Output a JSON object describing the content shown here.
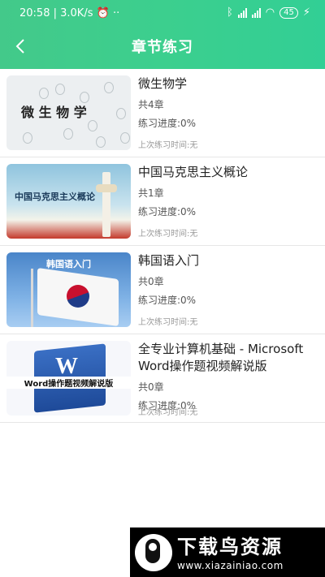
{
  "status_bar": {
    "time": "20:58",
    "speed": "3.0K/s",
    "more": "··",
    "battery": "45"
  },
  "header": {
    "back_icon": "chevron-left-icon",
    "title": "章节练习"
  },
  "courses": [
    {
      "title": "微生物学",
      "chapters": "共4章",
      "progress": "练习进度:0%",
      "last": "上次练习时间:无",
      "thumb_label": "微 生 物 学"
    },
    {
      "title": "中国马克思主义概论",
      "chapters": "共1章",
      "progress": "练习进度:0%",
      "last": "上次练习时间:无",
      "thumb_label": "中国马克思主义概论"
    },
    {
      "title": "韩国语入门",
      "chapters": "共0章",
      "progress": "练习进度:0%",
      "last": "上次练习时间:无",
      "thumb_label": "韩国语入门"
    },
    {
      "title": "全专业计算机基础 - Microsoft Word操作题视频解说版",
      "chapters": "共0章",
      "progress": "练习进度:0%",
      "last": "上次练习时间:无",
      "thumb_label": "Word操作题视频解说版"
    }
  ],
  "watermark": {
    "title": "下载鸟资源",
    "url": "www.xiazainiao.com"
  },
  "colors": {
    "header_green": "#3ccf8e"
  }
}
